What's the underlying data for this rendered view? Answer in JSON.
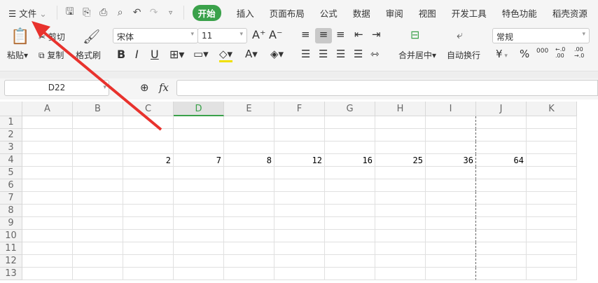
{
  "menu": {
    "file": "文件",
    "tabs": [
      "开始",
      "插入",
      "页面布局",
      "公式",
      "数据",
      "审阅",
      "视图",
      "开发工具",
      "特色功能",
      "稻壳资源"
    ]
  },
  "ribbon": {
    "paste": "粘贴",
    "cut": "剪切",
    "copy": "复制",
    "format_painter": "格式刷",
    "font": "宋体",
    "font_size": "11",
    "merge_center": "合并居中",
    "wrap_text": "自动换行",
    "number_format": "常规",
    "currency": "¥",
    "percent": "%",
    "thousands": "000",
    "inc_decimal": "←.0 .00",
    "dec_decimal": ".00 →.0"
  },
  "formula_bar": {
    "name_box": "D22",
    "fx": "fx",
    "value": ""
  },
  "sheet": {
    "columns": [
      "A",
      "B",
      "C",
      "D",
      "E",
      "F",
      "G",
      "H",
      "I",
      "J",
      "K"
    ],
    "active_column": "D",
    "rows": [
      "1",
      "2",
      "3",
      "4",
      "5",
      "6",
      "7",
      "8",
      "9",
      "10",
      "11",
      "12",
      "13"
    ],
    "row4_values": {
      "C": "2",
      "D": "7",
      "E": "8",
      "F": "12",
      "G": "16",
      "H": "25",
      "I": "36",
      "J": "64"
    }
  },
  "colors": {
    "accent": "#3aa14a",
    "arrow": "#e8322d"
  }
}
